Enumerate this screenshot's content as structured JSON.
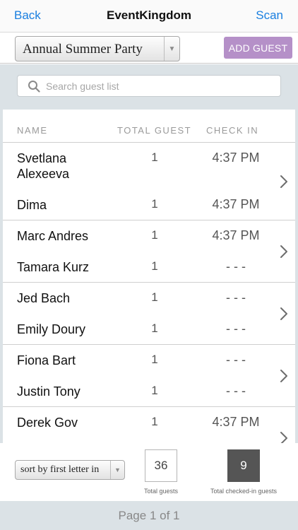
{
  "nav": {
    "back_label": "Back",
    "title": "EventKingdom",
    "scan_label": "Scan"
  },
  "toolbar": {
    "event_selected": "Annual Summer Party",
    "add_guest_label": "ADD GUEST"
  },
  "search": {
    "placeholder": "Search guest list"
  },
  "table": {
    "headers": {
      "name": "NAME",
      "total": "TOTAL GUEST",
      "checkin": "CHECK IN"
    },
    "groups": [
      {
        "rows": [
          {
            "name": "Svetlana Alexeeva",
            "total": "1",
            "checkin": "4:37 PM"
          },
          {
            "name": "Dima",
            "total": "1",
            "checkin": "4:37 PM"
          }
        ]
      },
      {
        "rows": [
          {
            "name": "Marc Andres",
            "total": "1",
            "checkin": "4:37 PM"
          },
          {
            "name": "Tamara Kurz",
            "total": "1",
            "checkin": "- - -"
          }
        ]
      },
      {
        "rows": [
          {
            "name": "Jed Bach",
            "total": "1",
            "checkin": "- - -"
          },
          {
            "name": "Emily Doury",
            "total": "1",
            "checkin": "- - -"
          }
        ]
      },
      {
        "rows": [
          {
            "name": "Fiona Bart",
            "total": "1",
            "checkin": "- - -"
          },
          {
            "name": "Justin Tony",
            "total": "1",
            "checkin": "- - -"
          }
        ]
      },
      {
        "rows": [
          {
            "name": "Derek Gov",
            "total": "1",
            "checkin": "4:37 PM"
          }
        ]
      }
    ]
  },
  "footer": {
    "sort_selected": "sort by first letter in",
    "total_guests": "36",
    "total_guests_label": "Total guests",
    "checked_in": "9",
    "checked_in_label": "Total checked-in guests"
  },
  "pagination": {
    "label": "Page 1 of 1"
  },
  "colors": {
    "accent": "#1a7fe0",
    "add_guest": "#b590c8",
    "checked_box": "#555555",
    "panel": "#dbe2e6"
  },
  "icons": {
    "search": "search-icon",
    "chevron": "chevron-right-icon",
    "dropdown": "dropdown-arrow-icon"
  }
}
